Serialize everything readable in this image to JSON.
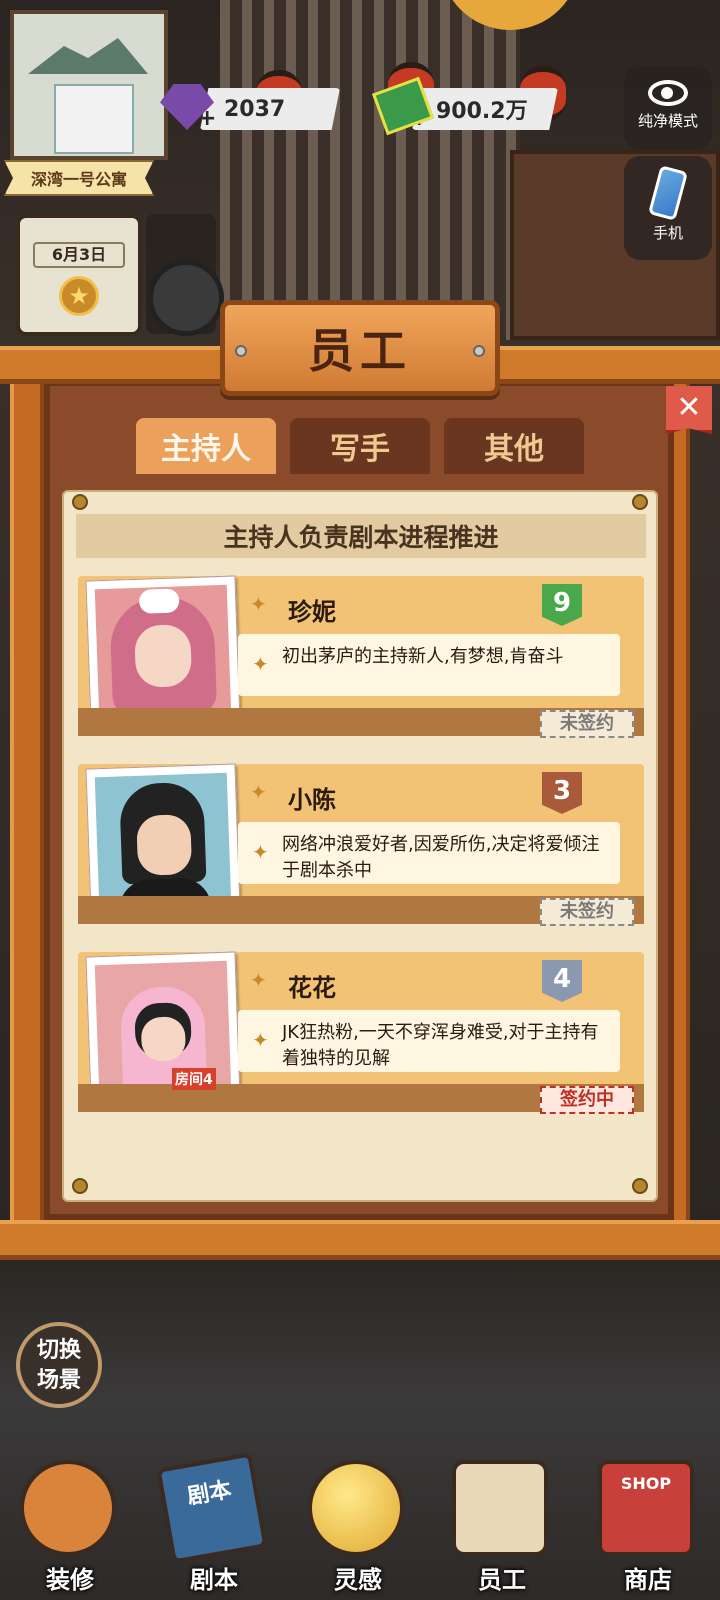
{
  "header": {
    "gems": "2037",
    "money": "900.2万",
    "address": "深湾一号公寓",
    "date": "6月3日"
  },
  "side_buttons": {
    "pure_mode": "纯净模式",
    "phone": "手机"
  },
  "dialog": {
    "title": "员工",
    "tabs": [
      {
        "label": "主持人",
        "active": true
      },
      {
        "label": "写手",
        "active": false
      },
      {
        "label": "其他",
        "active": false
      }
    ],
    "subtitle": "主持人负责剧本进程推进",
    "staff": [
      {
        "name": "珍妮",
        "level": "9",
        "level_color": "#4aa84a",
        "desc": "初出茅庐的主持新人,有梦想,肯奋斗",
        "status": "未签约"
      },
      {
        "name": "小陈",
        "level": "3",
        "level_color": "#a85a3a",
        "desc": "网络冲浪爱好者,因爱所伤,决定将爱倾注于剧本杀中",
        "status": "未签约"
      },
      {
        "name": "花花",
        "level": "4",
        "level_color": "#8a98b0",
        "desc": "JK狂热粉,一天不穿浑身难受,对于主持有着独特的见解",
        "status": "签约中",
        "room": "房间4"
      }
    ]
  },
  "swap_scene": "切换场景",
  "nav": [
    {
      "label": "装修",
      "icon": "house-icon"
    },
    {
      "label": "剧本",
      "icon": "script-book-icon",
      "book_text": "剧本"
    },
    {
      "label": "灵感",
      "icon": "lightbulb-icon"
    },
    {
      "label": "员工",
      "icon": "badge-icon"
    },
    {
      "label": "商店",
      "icon": "shop-icon",
      "shop_text": "SHOP"
    }
  ]
}
